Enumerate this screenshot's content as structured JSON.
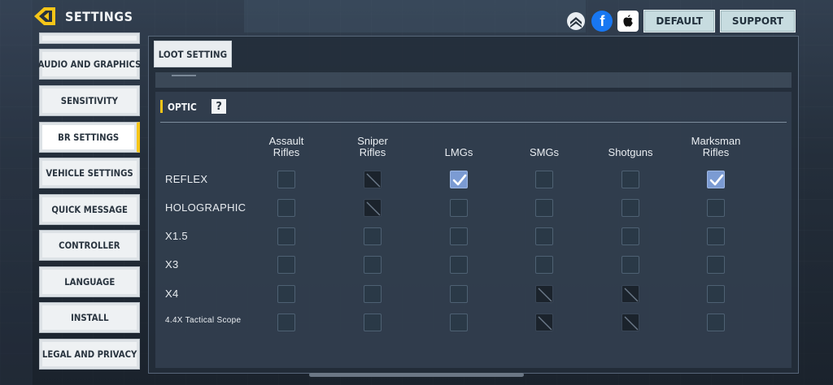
{
  "header": {
    "title": "SETTINGS"
  },
  "top_buttons": {
    "default_label": "DEFAULT",
    "support_label": "SUPPORT"
  },
  "sidebar": {
    "items": [
      {
        "label": "AUDIO AND GRAPHICS"
      },
      {
        "label": "SENSITIVITY"
      },
      {
        "label": "BR SETTINGS",
        "active": true
      },
      {
        "label": "VEHICLE SETTINGS"
      },
      {
        "label": "QUICK MESSAGE"
      },
      {
        "label": "CONTROLLER"
      },
      {
        "label": "LANGUAGE"
      },
      {
        "label": "INSTALL"
      },
      {
        "label": "LEGAL AND PRIVACY"
      }
    ]
  },
  "tab": {
    "label": "LOOT SETTING"
  },
  "section": {
    "title": "OPTIC",
    "help_icon": "?"
  },
  "columns": [
    {
      "label": "Assault Rifles",
      "line1": "Assault",
      "line2": "Rifles"
    },
    {
      "label": "Sniper Rifles",
      "line1": "Sniper",
      "line2": "Rifles"
    },
    {
      "label": "LMGs",
      "line1": "",
      "line2": "LMGs"
    },
    {
      "label": "SMGs",
      "line1": "",
      "line2": "SMGs"
    },
    {
      "label": "Shotguns",
      "line1": "",
      "line2": "Shotguns"
    },
    {
      "label": "Marksman Rifles",
      "line1": "Marksman",
      "line2": "Rifles"
    }
  ],
  "rows": [
    {
      "label": "REFLEX",
      "cells": [
        "off",
        "disabled",
        "checked",
        "off",
        "off",
        "checked"
      ]
    },
    {
      "label": "HOLOGRAPHIC",
      "cells": [
        "off",
        "disabled",
        "off",
        "off",
        "off",
        "off"
      ]
    },
    {
      "label": "X1.5",
      "cells": [
        "off",
        "off",
        "off",
        "off",
        "off",
        "off"
      ]
    },
    {
      "label": "X3",
      "cells": [
        "off",
        "off",
        "off",
        "off",
        "off",
        "off"
      ]
    },
    {
      "label": "X4",
      "cells": [
        "off",
        "off",
        "off",
        "disabled",
        "disabled",
        "off"
      ]
    },
    {
      "label": "4.4X Tactical Scope",
      "cells": [
        "off",
        "off",
        "off",
        "disabled",
        "disabled",
        "off"
      ]
    }
  ],
  "colors": {
    "accent": "#f5c518",
    "checked": "#7b9bd3"
  },
  "icons": {
    "back": "back-arrow-icon",
    "rank": "rank-chevron-icon",
    "facebook": "facebook-icon",
    "apple": "apple-icon"
  }
}
